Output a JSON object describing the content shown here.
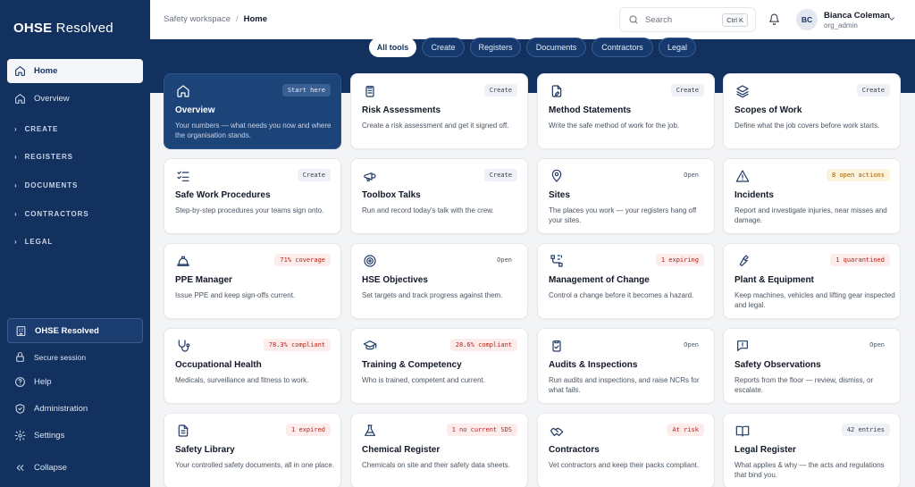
{
  "app": {
    "logo_bold": "OHSE",
    "logo_light": " Resolved"
  },
  "sidebar": {
    "home": "Home",
    "overview": "Overview",
    "sections": [
      "CREATE",
      "REGISTERS",
      "DOCUMENTS",
      "CONTRACTORS",
      "LEGAL"
    ],
    "org": "OHSE Resolved",
    "secure": "Secure session",
    "help": "Help",
    "administration": "Administration",
    "settings": "Settings",
    "collapse": "Collapse"
  },
  "topbar": {
    "breadcrumb_root": "Safety workspace",
    "breadcrumb_current": "Home",
    "search_placeholder": "Search",
    "search_shortcut": "Ctrl K",
    "user_initials": "BC",
    "user_name": "Bianca Coleman",
    "user_role": "org_admin"
  },
  "filters": [
    "All tools",
    "Create",
    "Registers",
    "Documents",
    "Contractors",
    "Legal"
  ],
  "cards": [
    {
      "icon": "home-icon",
      "title": "Overview",
      "desc": "Your numbers — what needs you now and where the organisation stands.",
      "badge": "Start here",
      "tone": "hero"
    },
    {
      "icon": "clipboard-list-icon",
      "title": "Risk Assessments",
      "desc": "Create a risk assessment and get it signed off.",
      "badge": "Create",
      "tone": "neutral"
    },
    {
      "icon": "file-pen-icon",
      "title": "Method Statements",
      "desc": "Write the safe method of work for the job.",
      "badge": "Create",
      "tone": "neutral"
    },
    {
      "icon": "layers-icon",
      "title": "Scopes of Work",
      "desc": "Define what the job covers before work starts.",
      "badge": "Create",
      "tone": "neutral"
    },
    {
      "icon": "list-checks-icon",
      "title": "Safe Work Procedures",
      "desc": "Step-by-step procedures your teams sign onto.",
      "badge": "Create",
      "tone": "neutral"
    },
    {
      "icon": "megaphone-icon",
      "title": "Toolbox Talks",
      "desc": "Run and record today's talk with the crew.",
      "badge": "Create",
      "tone": "neutral"
    },
    {
      "icon": "map-pin-icon",
      "title": "Sites",
      "desc": "The places you work — your registers hang off your sites.",
      "badge": "Open",
      "tone": "plain"
    },
    {
      "icon": "warning-triangle-icon",
      "title": "Incidents",
      "desc": "Report and investigate injuries, near misses and damage.",
      "badge": "8 open actions",
      "tone": "amber"
    },
    {
      "icon": "hard-hat-icon",
      "title": "PPE Manager",
      "desc": "Issue PPE and keep sign-offs current.",
      "badge": "71% coverage",
      "tone": "red"
    },
    {
      "icon": "target-icon",
      "title": "HSE Objectives",
      "desc": "Set targets and track progress against them.",
      "badge": "Open",
      "tone": "plain"
    },
    {
      "icon": "workflow-icon",
      "title": "Management of Change",
      "desc": "Control a change before it becomes a hazard.",
      "badge": "1 expiring",
      "tone": "red"
    },
    {
      "icon": "wrench-icon",
      "title": "Plant & Equipment",
      "desc": "Keep machines, vehicles and lifting gear inspected and legal.",
      "badge": "1 quarantined",
      "tone": "red"
    },
    {
      "icon": "stethoscope-icon",
      "title": "Occupational Health",
      "desc": "Medicals, surveillance and fitness to work.",
      "badge": "78.3% compliant",
      "tone": "red"
    },
    {
      "icon": "graduation-cap-icon",
      "title": "Training & Competency",
      "desc": "Who is trained, competent and current.",
      "badge": "28.6% compliant",
      "tone": "red"
    },
    {
      "icon": "clipboard-check-icon",
      "title": "Audits & Inspections",
      "desc": "Run audits and inspections, and raise NCRs for what fails.",
      "badge": "Open",
      "tone": "plain"
    },
    {
      "icon": "message-alert-icon",
      "title": "Safety Observations",
      "desc": "Reports from the floor — review, dismiss, or escalate.",
      "badge": "Open",
      "tone": "plain"
    },
    {
      "icon": "file-text-icon",
      "title": "Safety Library",
      "desc": "Your controlled safety documents, all in one place.",
      "badge": "1 expired",
      "tone": "red"
    },
    {
      "icon": "flask-icon",
      "title": "Chemical Register",
      "desc": "Chemicals on site and their safety data sheets.",
      "badge": "1 no current SDS",
      "tone": "red"
    },
    {
      "icon": "handshake-icon",
      "title": "Contractors",
      "desc": "Vet contractors and keep their packs compliant.",
      "badge": "At risk",
      "tone": "red"
    },
    {
      "icon": "book-open-icon",
      "title": "Legal Register",
      "desc": "What applies & why — the acts and regulations that bind you.",
      "badge": "42 entries",
      "tone": "neutral"
    }
  ]
}
